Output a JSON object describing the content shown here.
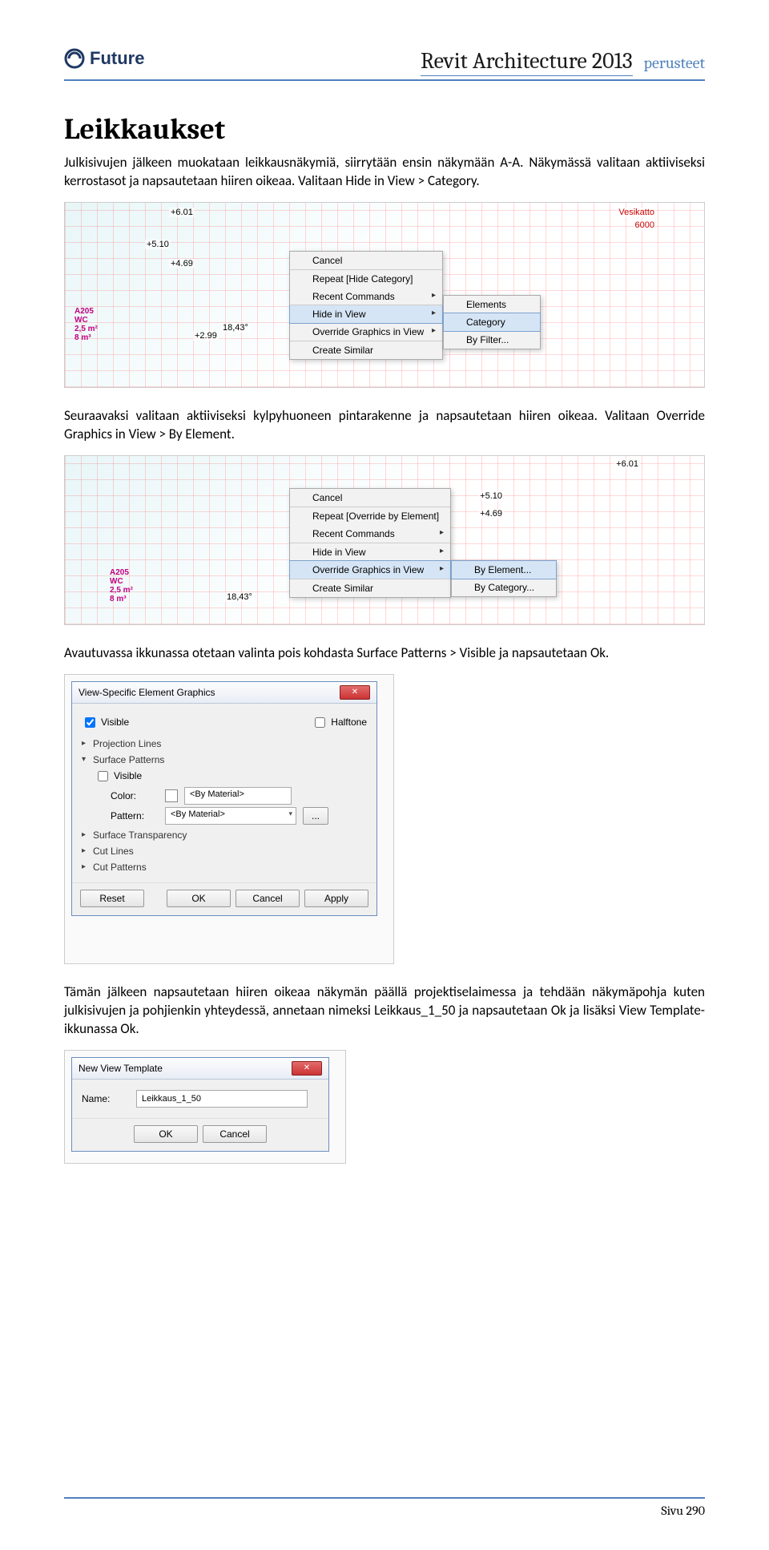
{
  "header": {
    "logo_text": "Future",
    "title": "Revit Architecture 2013",
    "subtitle": "perusteet"
  },
  "section_heading": "Leikkaukset",
  "para1": "Julkisivujen jälkeen muokataan leikkausnäkymiä, siirrytään ensin näkymään A-A. Näkymässä valitaan aktiiviseksi kerrostasot ja napsautetaan hiiren oikeaa. Valitaan Hide in View > Category.",
  "para2": "Seuraavaksi valitaan aktiiviseksi kylpyhuoneen pintarakenne ja napsautetaan hiiren oikeaa. Valitaan Override Graphics in View > By Element.",
  "para3": "Avautuvassa ikkunassa otetaan valinta pois kohdasta Surface Patterns > Visible ja napsautetaan Ok.",
  "para4": "Tämän jälkeen napsautetaan hiiren oikeaa näkymän päällä projektiselaimessa ja tehdään näkymäpohja kuten julkisivujen ja pohjienkin yhteydessä, annetaan nimeksi Leikkaus_1_50 ja napsautetaan Ok ja lisäksi View Template-ikkunassa Ok.",
  "fig1": {
    "levels": [
      "+6.01",
      "+5.10",
      "+4.69",
      "+2.99",
      "18,43°"
    ],
    "vesi_label": "Vesikatto",
    "vesi_val": "6000",
    "room": "A205",
    "room_wc": "WC",
    "room_a": "2,5 m²",
    "room_v": "8 m³",
    "menu1": {
      "cancel": "Cancel",
      "repeat": "Repeat [Hide Category]",
      "recent": "Recent Commands",
      "hide": "Hide in View",
      "override": "Override Graphics in View",
      "create": "Create Similar"
    },
    "submenu": {
      "elements": "Elements",
      "category": "Category",
      "byfilter": "By Filter..."
    }
  },
  "fig2": {
    "levels": [
      "+6.01",
      "+5.10",
      "+4.69",
      "18,43°"
    ],
    "room": "A205",
    "room_wc": "WC",
    "room_a": "2,5 m²",
    "room_v": "8 m³",
    "menu1": {
      "cancel": "Cancel",
      "repeat": "Repeat [Override by Element]",
      "recent": "Recent Commands",
      "hide": "Hide in View",
      "override": "Override Graphics in View",
      "create": "Create Similar"
    },
    "submenu": {
      "byelem": "By Element...",
      "bycat": "By Category..."
    }
  },
  "fig3": {
    "title": "View-Specific Element Graphics",
    "visible": "Visible",
    "halftone": "Halftone",
    "proj": "Projection Lines",
    "surf": "Surface Patterns",
    "surf_visible": "Visible",
    "color_lbl": "Color:",
    "color_val": "<By Material>",
    "pattern_lbl": "Pattern:",
    "pattern_val": "<By Material>",
    "surftrans": "Surface Transparency",
    "cutlines": "Cut Lines",
    "cutpat": "Cut Patterns",
    "reset": "Reset",
    "ok": "OK",
    "cancel": "Cancel",
    "apply": "Apply"
  },
  "fig4": {
    "title": "New View Template",
    "name_lbl": "Name:",
    "name_val": "Leikkaus_1_50",
    "ok": "OK",
    "cancel": "Cancel"
  },
  "footer": {
    "page": "Sivu 290"
  }
}
